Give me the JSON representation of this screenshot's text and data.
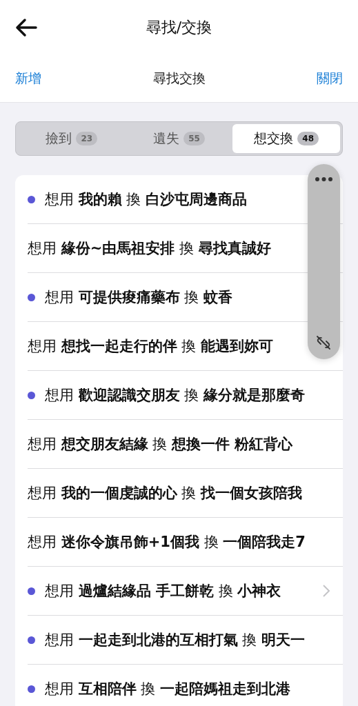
{
  "header": {
    "title": "尋找/交換"
  },
  "toolbar": {
    "left": "新增",
    "title": "尋找交換",
    "right": "關閉"
  },
  "tabs": [
    {
      "label": "撿到",
      "count": "23",
      "selected": false
    },
    {
      "label": "遺失",
      "count": "55",
      "selected": false
    },
    {
      "label": "想交換",
      "count": "48",
      "selected": true
    }
  ],
  "rows": [
    {
      "text": "想用 **我的賴** 換 **白沙屯周邊商品**",
      "unread": true,
      "chevron": false
    },
    {
      "text": "想用 **緣份~由馬祖安排** 換 **尋找真誠好**",
      "unread": false,
      "chevron": false
    },
    {
      "text": "想用 **可提供痠痛藥布** 換 **蚊香**",
      "unread": true,
      "chevron": false
    },
    {
      "text": "想用 **想找一起走行的伴** 換 **能遇到妳可**",
      "unread": false,
      "chevron": false
    },
    {
      "text": "想用 **歡迎認識交朋友** 換 **緣分就是那麼奇**",
      "unread": true,
      "chevron": false
    },
    {
      "text": "想用 **想交朋友結緣** 換 **想換一件 粉紅背心**",
      "unread": false,
      "chevron": false
    },
    {
      "text": "想用 **我的一個虔誠的心** 換 **找一個女孩陪我**",
      "unread": false,
      "chevron": false
    },
    {
      "text": "想用 **迷你令旗吊飾+1個我** 換 **一個陪我走7**",
      "unread": false,
      "chevron": false
    },
    {
      "text": "想用 **過爐結緣品 手工餅乾** 換 **小神衣**",
      "unread": true,
      "chevron": true
    },
    {
      "text": "想用 **一起走到北港的互相打氣** 換 **明天一**",
      "unread": true,
      "chevron": false
    },
    {
      "text": "想用 **互相陪伴** 換 **一起陪媽祖走到北港**",
      "unread": true,
      "chevron": false
    }
  ]
}
